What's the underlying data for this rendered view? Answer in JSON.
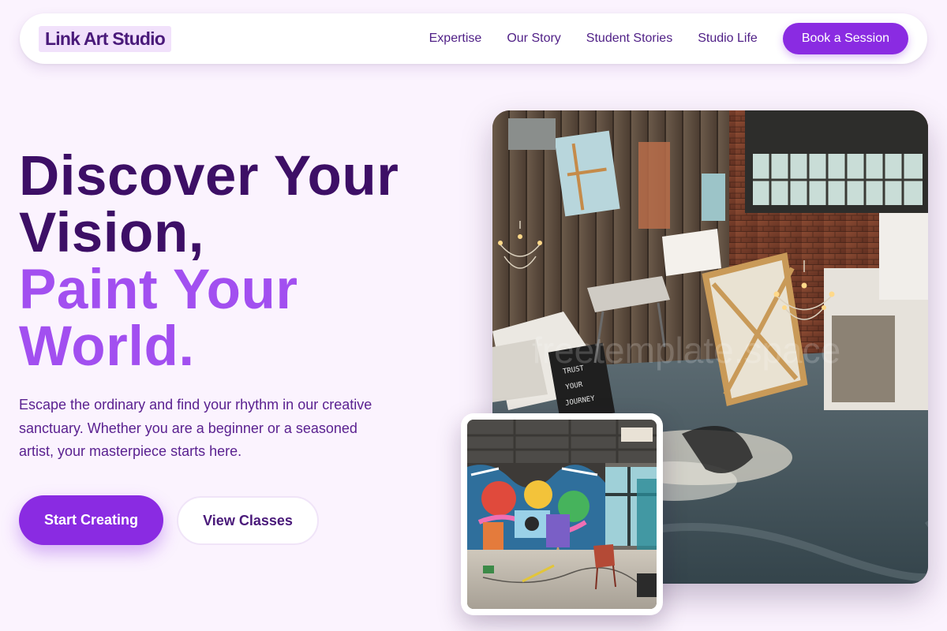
{
  "nav": {
    "logo": "Link Art Studio",
    "links": [
      "Expertise",
      "Our Story",
      "Student Stories",
      "Studio Life"
    ],
    "cta": "Book a Session"
  },
  "hero": {
    "title_line1": "Discover Your",
    "title_line2": "Vision,",
    "title_line3": "Paint Your",
    "title_line4": "World.",
    "description": "Escape the ordinary and find your rhythm in our creative sanctuary. Whether you are a beginner or a seasoned artist, your masterpiece starts here.",
    "primary_button": "Start Creating",
    "secondary_button": "View Classes"
  },
  "images": {
    "main_watermark": "freetemplate.space",
    "sign_text": "TRUST YOUR JOURNEY"
  },
  "colors": {
    "accent": "#8a2be2",
    "title_dark": "#3d0f66",
    "title_light": "#a24ff0",
    "page_background": "#fbf3fe"
  }
}
